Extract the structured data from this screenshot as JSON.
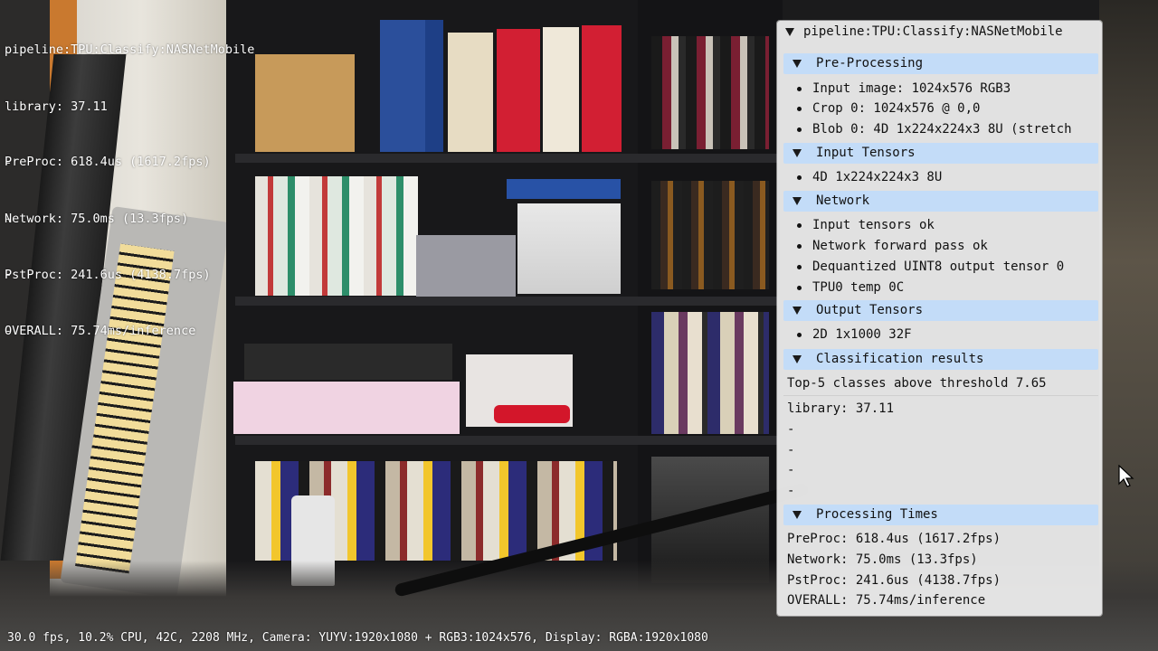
{
  "overlay": {
    "pipeline_line": "pipeline:TPU:Classify:NASNetMobile",
    "library_line": "library: 37.11",
    "dash_lines": [
      "-",
      "-",
      "-",
      "-"
    ],
    "preproc_line": "PreProc: 618.4us (1617.2fps)",
    "network_line": "Network: 75.0ms (13.3fps)",
    "pstproc_line": "PstProc: 241.6us (4138.7fps)",
    "overall_line": "OVERALL: 75.74ms/inference"
  },
  "statusbar": {
    "text": "30.0 fps, 10.2% CPU, 42C, 2208 MHz, Camera: YUYV:1920x1080 + RGB3:1024x576, Display: RGBA:1920x1080"
  },
  "panel": {
    "title": "pipeline:TPU:Classify:NASNetMobile",
    "pre_processing": {
      "header": "Pre-Processing",
      "items": [
        "Input image: 1024x576 RGB3",
        "Crop 0: 1024x576 @ 0,0",
        "Blob 0: 4D 1x224x224x3 8U (stretch"
      ]
    },
    "input_tensors": {
      "header": "Input Tensors",
      "items": [
        "4D 1x224x224x3 8U"
      ]
    },
    "network": {
      "header": "Network",
      "items": [
        "Input tensors ok",
        "Network forward pass ok",
        "Dequantized UINT8 output tensor 0",
        "TPU0 temp 0C"
      ]
    },
    "output_tensors": {
      "header": "Output Tensors",
      "items": [
        "2D 1x1000 32F"
      ]
    },
    "classification": {
      "header": "Classification results",
      "threshold_text": "Top-5 classes above threshold 7.65",
      "results": [
        "library: 37.11",
        "-",
        "-",
        "-",
        "-"
      ]
    },
    "processing_times": {
      "header": "Processing Times",
      "lines": [
        "PreProc: 618.4us (1617.2fps)",
        "Network: 75.0ms (13.3fps)",
        "PstProc: 241.6us (4138.7fps)",
        "OVERALL: 75.74ms/inference"
      ]
    }
  },
  "colors": {
    "section_header": "#c3dcf8",
    "panel_bg": "#eeeeee",
    "overlay_text": "#ffffff"
  }
}
